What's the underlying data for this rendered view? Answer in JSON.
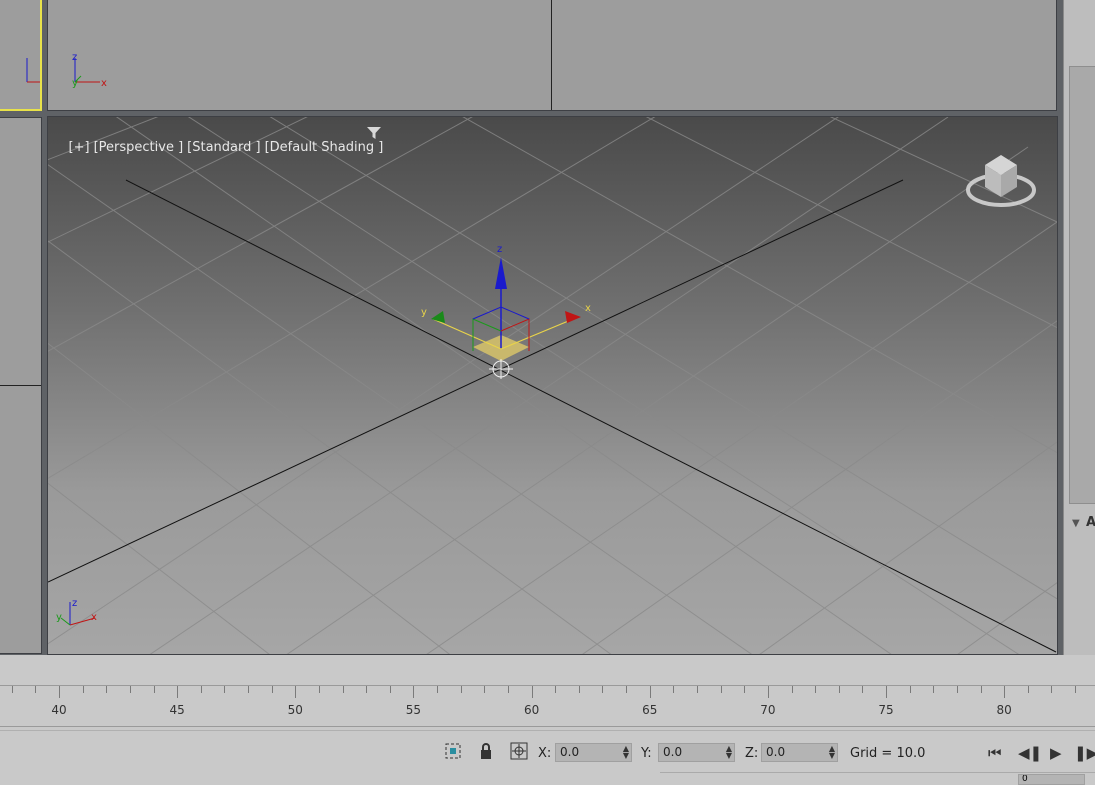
{
  "viewport": {
    "label_plus": "[+]",
    "label_view": "[Perspective ]",
    "label_standard": "[Standard ]",
    "label_shading": "[Default Shading ]"
  },
  "gizmo": {
    "x": "x",
    "y": "y",
    "z": "z"
  },
  "axis_tripod": {
    "x": "x",
    "y": "y",
    "z": "z"
  },
  "timeline": {
    "ticks": [
      "40",
      "45",
      "50",
      "55",
      "60",
      "65",
      "70",
      "75",
      "80"
    ]
  },
  "status": {
    "x_label": "X:",
    "x_value": "0.0",
    "y_label": "Y:",
    "y_value": "0.0",
    "z_label": "Z:",
    "z_value": "0.0",
    "grid": "Grid = 10.0",
    "frame_value": "0"
  },
  "colors": {
    "active_viewport_border": "#e8e24a",
    "x_axis": "#c01515",
    "y_axis": "#1a9a1a",
    "z_axis": "#1a1acc"
  }
}
